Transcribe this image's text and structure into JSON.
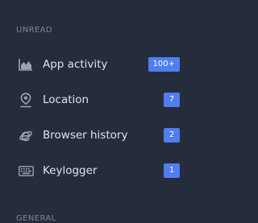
{
  "sections": {
    "unread_title": "UNREAD",
    "general_title": "GENERAL"
  },
  "nav": {
    "items": [
      {
        "label": "App activity",
        "count": "100+",
        "icon": "area-chart-icon"
      },
      {
        "label": "Location",
        "count": "7",
        "icon": "location-pin-icon"
      },
      {
        "label": "Browser history",
        "count": "2",
        "icon": "internet-explorer-icon"
      },
      {
        "label": "Keylogger",
        "count": "1",
        "icon": "keyboard-icon"
      }
    ]
  },
  "colors": {
    "background": "#252c3c",
    "badge": "#4f7ef0",
    "icon": "#9aa3b8",
    "text": "#dfe3ec",
    "section_label": "#7d8598"
  }
}
